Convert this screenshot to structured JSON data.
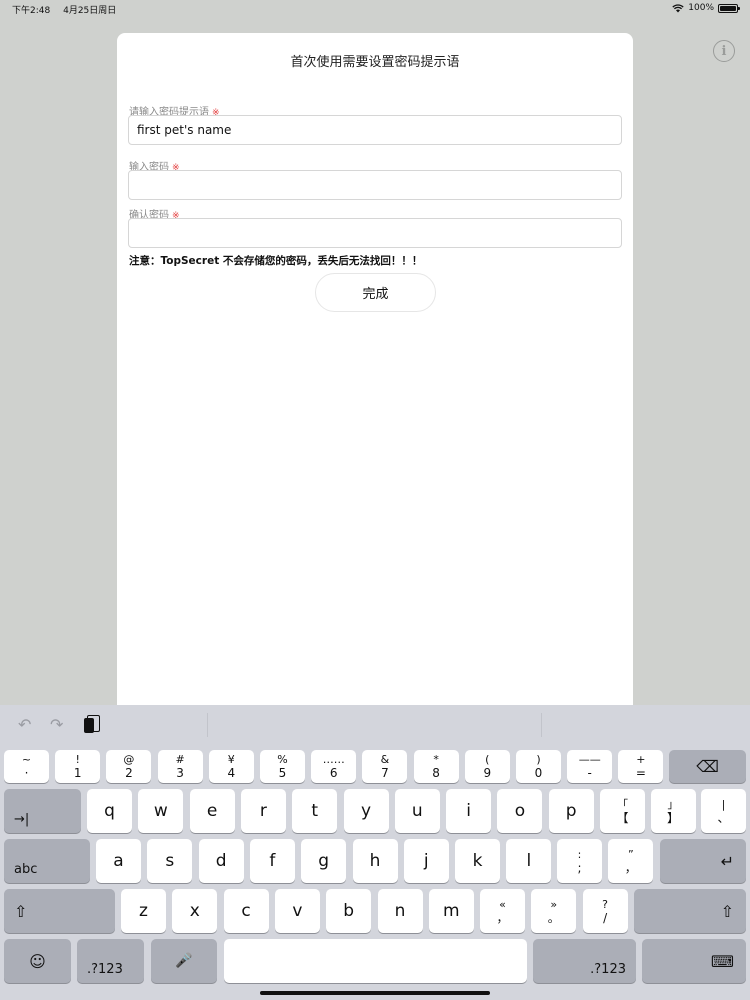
{
  "status": {
    "time": "下午2:48",
    "date": "4月25日周日",
    "battery": "100%",
    "battery_level": 1.0
  },
  "info": {
    "glyph": "i"
  },
  "dialog": {
    "title": "首次使用需要设置密码提示语",
    "hint_label": "请输入密码提示语",
    "hint_value": "first pet's name",
    "password_label": "输入密码",
    "password_value": "",
    "confirm_label": "确认密码",
    "confirm_value": "",
    "required_mark": "※",
    "notice": "注意：TopSecret 不会存储您的密码，丢失后无法找回！！！",
    "done_label": "完成"
  },
  "keyboard": {
    "toolbar": {
      "undo": "↶",
      "redo": "↷"
    },
    "row1": [
      {
        "sym": "~",
        "base": "·"
      },
      {
        "sym": "!",
        "base": "1"
      },
      {
        "sym": "@",
        "base": "2"
      },
      {
        "sym": "#",
        "base": "3"
      },
      {
        "sym": "¥",
        "base": "4"
      },
      {
        "sym": "%",
        "base": "5"
      },
      {
        "sym": "……",
        "base": "6"
      },
      {
        "sym": "&",
        "base": "7"
      },
      {
        "sym": "*",
        "base": "8"
      },
      {
        "sym": "(",
        "base": "9"
      },
      {
        "sym": ")",
        "base": "0"
      },
      {
        "sym": "——",
        "base": "-"
      },
      {
        "sym": "+",
        "base": "="
      }
    ],
    "row2_letters": [
      "q",
      "w",
      "e",
      "r",
      "t",
      "y",
      "u",
      "i",
      "o",
      "p"
    ],
    "row2_symbols": [
      {
        "sym": "「",
        "base": "【"
      },
      {
        "sym": "」",
        "base": "】"
      },
      {
        "sym": "|",
        "base": "、"
      }
    ],
    "row3_letters": [
      "a",
      "s",
      "d",
      "f",
      "g",
      "h",
      "j",
      "k",
      "l"
    ],
    "row3_symbols": [
      {
        "sym": ":",
        "base": ";"
      },
      {
        "sym": "”",
        "base": "，"
      }
    ],
    "row4_letters": [
      "z",
      "x",
      "c",
      "v",
      "b",
      "n",
      "m"
    ],
    "row4_symbols": [
      {
        "sym": "«",
        "base": "，"
      },
      {
        "sym": "»",
        "base": "。"
      },
      {
        "sym": "?",
        "base": "/"
      }
    ],
    "delete": "⌫",
    "tab": "→|",
    "abc": "abc",
    "return": "↵",
    "shift": "⇧",
    "emoji": "☺",
    "num_left": ".?123",
    "mic": "🎤",
    "num_right": ".?123",
    "hide": "⌨"
  }
}
